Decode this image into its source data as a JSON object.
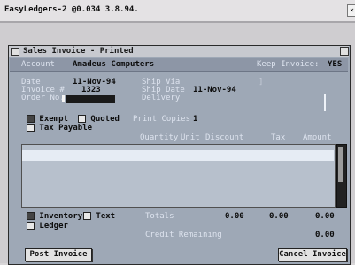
{
  "app": {
    "title": "EasyLedgers-2 @0.034 3.8.94.",
    "close_glyph": "×"
  },
  "invoice_window": {
    "title": "Sales Invoice - Printed",
    "account_label": "Account",
    "account_value": "Amadeus Computers",
    "keep_invoice_label": "Keep Invoice:",
    "keep_invoice_value": "YES"
  },
  "fields": {
    "date_label": "Date",
    "date_value": "11-Nov-94",
    "invoice_no_label": "Invoice #",
    "invoice_no_value": "1323",
    "order_no_label": "Order No.",
    "ship_via_label": "Ship Via",
    "ship_date_label": "Ship Date",
    "ship_date_value": "11-Nov-94",
    "delivery_label": "Delivery"
  },
  "options": {
    "exempt_label": "Exempt",
    "quoted_label": "Quoted",
    "tax_payable_label": "Tax Payable",
    "print_copies_label": "Print Copies",
    "print_copies_value": "1"
  },
  "table": {
    "columns": [
      "Quantity",
      "Unit",
      "Discount",
      "Tax",
      "Amount"
    ]
  },
  "footer": {
    "inventory_label": "Inventory",
    "text_label": "Text",
    "ledger_label": "Ledger",
    "totals_label": "Totals",
    "totals": [
      "0.00",
      "0.00",
      "0.00"
    ],
    "credit_label": "Credit Remaining",
    "credit_value": "0.00"
  },
  "buttons": {
    "post": "Post Invoice",
    "cancel": "Cancel Invoice"
  },
  "colors": {
    "window_body": "#9ea8b6",
    "grid": "#b7c0cc",
    "titlebar": "#c7c9cf"
  }
}
